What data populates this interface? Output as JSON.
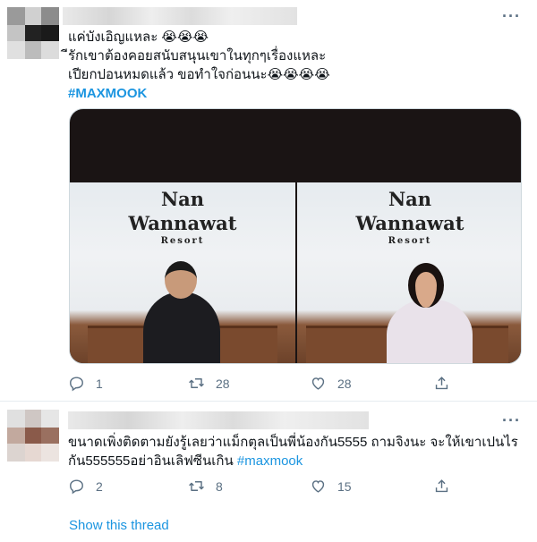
{
  "tweet1": {
    "lines": [
      "แค่บังเอิญแหละ 😭😭😭",
      "ีรักเขาต้องคอยสนับสนุนเขาในทุกๆเรื่องแหละ",
      "เปียกปอนหมดแล้ว ขอทำใจก่อนนะ😭😭😭😭"
    ],
    "hashtag": "#MAXMOOK",
    "photo_left_sign": [
      "Nan",
      "Wannawat",
      "Resort"
    ],
    "photo_right_sign": [
      "Nan",
      "Wannawat",
      "Resort"
    ],
    "reply_count": "1",
    "retweet_count": "28",
    "like_count": "28",
    "more_label": "···"
  },
  "tweet2": {
    "line1": "ขนาดเพิ่งติดตามยังรู้เลยว่าแม็กตุลเป็นพี่น้องกัน5555 ถามจิงนะ จะให้เขาเปนไร",
    "line2_text": "กัน555555อย่าอินเลิฟซีนเกิน ",
    "hashtag": "#maxmook",
    "reply_count": "2",
    "retweet_count": "8",
    "like_count": "15",
    "more_label": "···"
  },
  "show_thread": "Show this thread",
  "colors": {
    "link": "#1b95e0",
    "icon": "#5b7083",
    "divider": "#e6ecf0"
  }
}
